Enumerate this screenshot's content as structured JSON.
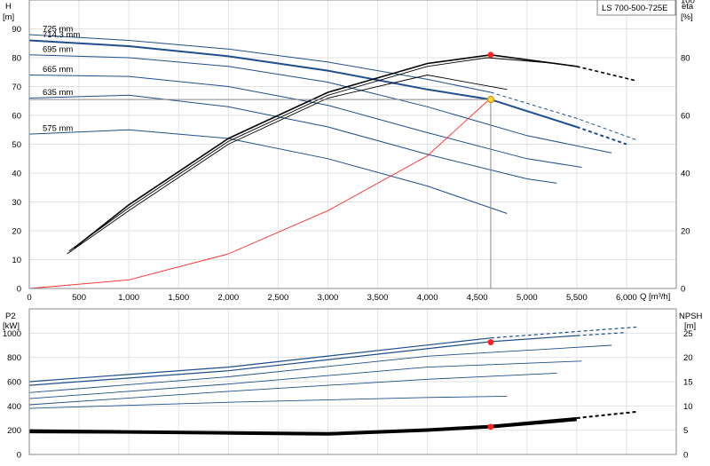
{
  "chart_data": [
    {
      "type": "line",
      "title": "LS 700-500-725E",
      "xlabel": "Q [m³/h]",
      "ylabel_left": "H",
      "ylabel_left_unit": "[m]",
      "ylabel_right": "eta",
      "ylabel_right_unit": "[%]",
      "xlim": [
        0,
        6500
      ],
      "ylim_left": [
        0,
        100
      ],
      "ylim_right": [
        0,
        100
      ],
      "x_ticks": [
        0,
        500,
        1000,
        1500,
        2000,
        2500,
        3000,
        3500,
        4000,
        4500,
        5000,
        5500,
        6000
      ],
      "x_tick_labels": [
        "0",
        "500",
        "1,000",
        "1,500",
        "2,000",
        "2,500",
        "3,000",
        "3,500",
        "4,000",
        "4,500",
        "5,000",
        "5,500",
        "6,000"
      ],
      "y_ticks_left": [
        0,
        10,
        20,
        30,
        40,
        50,
        60,
        70,
        80,
        90
      ],
      "y_ticks_right": [
        0,
        20,
        40,
        60,
        80,
        100
      ],
      "grid": true,
      "colors": {
        "head": "#1f4e8c",
        "eta": "#000000",
        "system": "#ff2a2a",
        "duty_head": "#ffd23f",
        "duty_eta": "#ff2020",
        "duty_line": "#888888"
      },
      "head_curves": [
        {
          "label": "725 mm",
          "solid": [
            [
              0,
              88
            ],
            [
              1000,
              86
            ],
            [
              2000,
              83
            ],
            [
              3000,
              78.5
            ],
            [
              4000,
              72.5
            ],
            [
              4636,
              68
            ]
          ],
          "dashed": [
            [
              4636,
              68
            ],
            [
              5500,
              59
            ],
            [
              6100,
              51.5
            ]
          ]
        },
        {
          "label": "714.3 mm",
          "solid": [
            [
              0,
              86
            ],
            [
              1000,
              84
            ],
            [
              2000,
              80.5
            ],
            [
              3000,
              75.5
            ],
            [
              4000,
              69
            ],
            [
              4636,
              65.5
            ],
            [
              5500,
              56
            ]
          ],
          "dashed": [
            [
              5500,
              56
            ],
            [
              6000,
              50
            ]
          ]
        },
        {
          "label": "695 mm",
          "solid": [
            [
              0,
              81
            ],
            [
              1000,
              80
            ],
            [
              2000,
              77
            ],
            [
              3000,
              71.5
            ],
            [
              4000,
              63
            ],
            [
              5000,
              53
            ],
            [
              5850,
              47
            ]
          ],
          "dashed": []
        },
        {
          "label": "665 mm",
          "solid": [
            [
              0,
              74
            ],
            [
              1000,
              73.5
            ],
            [
              2000,
              70
            ],
            [
              3000,
              63.5
            ],
            [
              4000,
              54
            ],
            [
              5000,
              45
            ],
            [
              5550,
              42
            ]
          ],
          "dashed": []
        },
        {
          "label": "635 mm",
          "solid": [
            [
              0,
              66
            ],
            [
              1000,
              67
            ],
            [
              2000,
              63
            ],
            [
              3000,
              56
            ],
            [
              4000,
              46.5
            ],
            [
              5000,
              38
            ],
            [
              5300,
              36.5
            ]
          ],
          "dashed": []
        },
        {
          "label": "575 mm",
          "solid": [
            [
              0,
              53.5
            ],
            [
              1000,
              55
            ],
            [
              2000,
              52
            ],
            [
              3000,
              45
            ],
            [
              4000,
              35.5
            ],
            [
              4800,
              26
            ]
          ],
          "dashed": []
        }
      ],
      "efficiency_curves": [
        {
          "solid": [
            [
              450,
              14
            ],
            [
              1000,
              29
            ],
            [
              2000,
              52
            ],
            [
              3000,
              68
            ],
            [
              4000,
              78
            ],
            [
              4636,
              81
            ],
            [
              5500,
              77
            ]
          ],
          "dashed": [
            [
              5500,
              77
            ],
            [
              6100,
              72
            ]
          ]
        },
        {
          "solid": [
            [
              400,
              13
            ],
            [
              1000,
              28
            ],
            [
              2000,
              51
            ],
            [
              3000,
              67
            ],
            [
              4000,
              77
            ],
            [
              4600,
              80
            ],
            [
              5300,
              78
            ]
          ],
          "dashed": []
        },
        {
          "solid": [
            [
              380,
              12
            ],
            [
              1000,
              27
            ],
            [
              2000,
              50
            ],
            [
              3000,
              66
            ],
            [
              4000,
              74
            ],
            [
              4800,
              69
            ]
          ],
          "dashed": []
        }
      ],
      "system_curve": [
        [
          0,
          0
        ],
        [
          1000,
          3
        ],
        [
          2000,
          12
        ],
        [
          3000,
          27
        ],
        [
          4000,
          46
        ],
        [
          4636,
          66
        ]
      ],
      "duty_point": {
        "q": 4636,
        "h": 65.5,
        "eta": 81
      }
    },
    {
      "type": "line",
      "ylabel_left": "P2",
      "ylabel_left_unit": "[kW]",
      "ylabel_right": "NPSH",
      "ylabel_right_unit": "[m]",
      "xlim": [
        0,
        6500
      ],
      "ylim_left": [
        0,
        1200
      ],
      "ylim_right": [
        0,
        30
      ],
      "y_ticks_left": [
        0,
        200,
        400,
        600,
        800,
        1000
      ],
      "y_ticks_right": [
        0,
        5,
        10,
        15,
        20,
        25
      ],
      "grid": true,
      "power_curves": [
        {
          "solid": [
            [
              0,
              600
            ],
            [
              2000,
              720
            ],
            [
              4636,
              960
            ]
          ],
          "dashed": [
            [
              4636,
              960
            ],
            [
              6100,
              1050
            ]
          ]
        },
        {
          "solid": [
            [
              0,
              570
            ],
            [
              2000,
              690
            ],
            [
              4636,
              930
            ],
            [
              5500,
              980
            ]
          ],
          "dashed": [
            [
              5500,
              980
            ],
            [
              6000,
              1005
            ]
          ]
        },
        {
          "solid": [
            [
              0,
              510
            ],
            [
              2000,
              640
            ],
            [
              4000,
              810
            ],
            [
              5850,
              900
            ]
          ],
          "dashed": []
        },
        {
          "solid": [
            [
              0,
              460
            ],
            [
              2000,
              580
            ],
            [
              4000,
              720
            ],
            [
              5550,
              770
            ]
          ],
          "dashed": []
        },
        {
          "solid": [
            [
              0,
              410
            ],
            [
              2000,
              520
            ],
            [
              4000,
              620
            ],
            [
              5300,
              670
            ]
          ],
          "dashed": []
        },
        {
          "solid": [
            [
              0,
              380
            ],
            [
              2000,
              430
            ],
            [
              4000,
              470
            ],
            [
              4800,
              480
            ]
          ],
          "dashed": []
        }
      ],
      "npsh_curves": [
        {
          "solid": [
            [
              0,
              5
            ],
            [
              1000,
              4.8
            ],
            [
              2000,
              4.6
            ],
            [
              3000,
              4.4
            ],
            [
              4000,
              5.2
            ],
            [
              4636,
              5.9
            ],
            [
              5500,
              7.5
            ]
          ],
          "dashed": [
            [
              5500,
              7.5
            ],
            [
              6100,
              8.8
            ]
          ]
        },
        {
          "solid": [
            [
              0,
              4.7
            ],
            [
              1000,
              4.5
            ],
            [
              2000,
              4.3
            ],
            [
              3000,
              4.2
            ],
            [
              4000,
              5.0
            ],
            [
              4636,
              5.7
            ],
            [
              5500,
              7.2
            ]
          ],
          "dashed": []
        },
        {
          "solid": [
            [
              0,
              4.5
            ],
            [
              1000,
              4.4
            ],
            [
              2000,
              4.2
            ],
            [
              3000,
              4.0
            ],
            [
              4000,
              4.8
            ],
            [
              4636,
              5.5
            ],
            [
              5500,
              7.0
            ]
          ],
          "dashed": []
        }
      ],
      "duty_point": {
        "q": 4636,
        "p2": 925,
        "npsh": 5.7
      }
    }
  ]
}
